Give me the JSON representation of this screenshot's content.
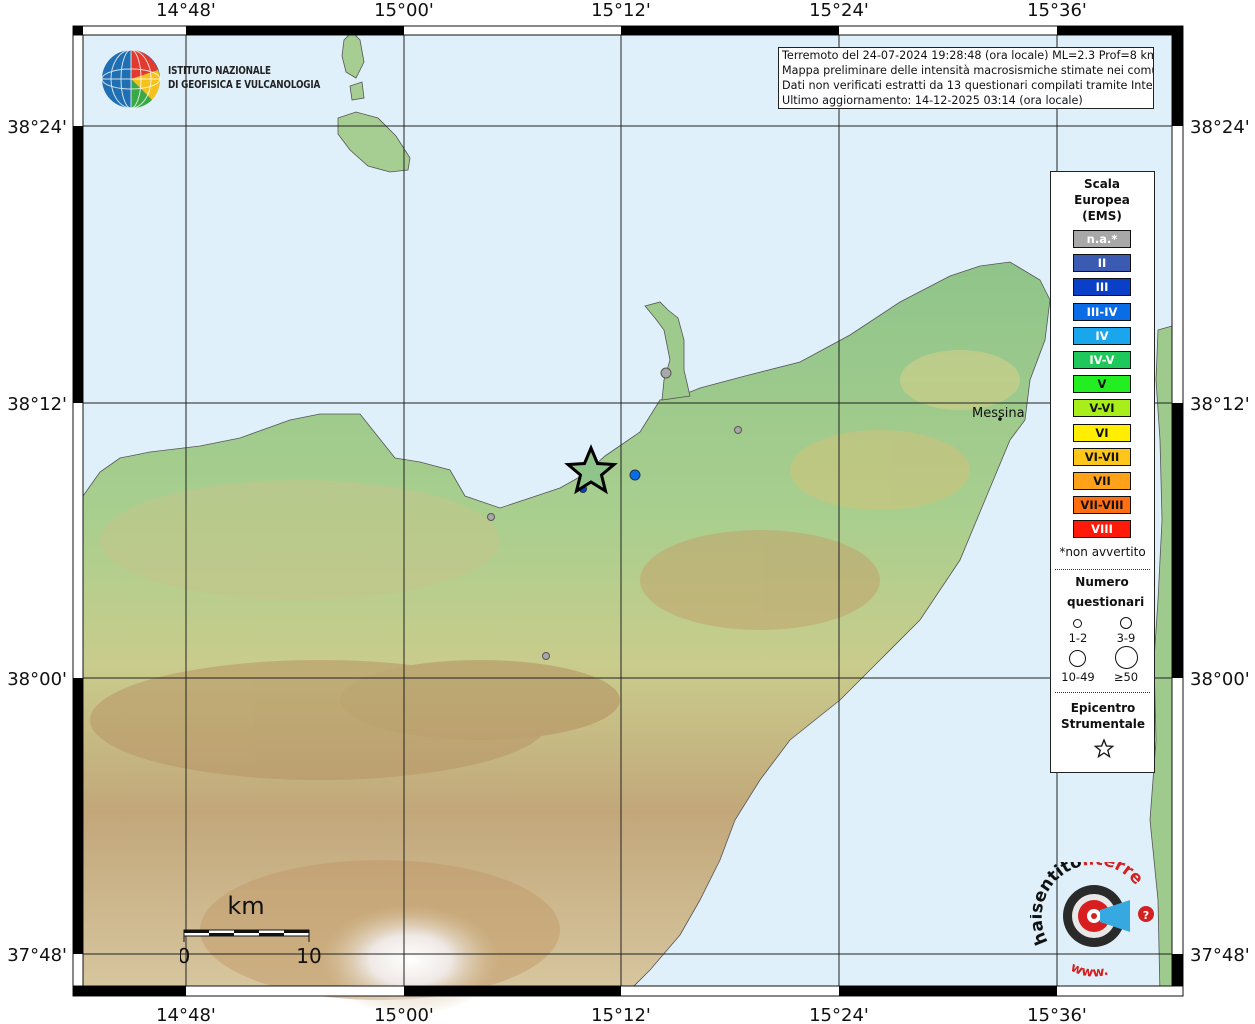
{
  "info_box": {
    "line1": "Terremoto del 24-07-2024 19:28:48 (ora locale) ML=2.3 Prof=8 km",
    "line2": "Mappa preliminare delle intensità macrosismiche stimate nei comuni",
    "line3": "Dati non verificati estratti da 13 questionari compilati tramite Internet.",
    "line4": "Ultimo aggiornamento: 14-12-2025 03:14 (ora locale)"
  },
  "institute": {
    "line1": "ISTITUTO NAZIONALE",
    "line2": "DI GEOFISICA E VULCANOLOGIA"
  },
  "axes": {
    "lon_labels": [
      "14°48'",
      "15°00'",
      "15°12'",
      "15°24'",
      "15°36'"
    ],
    "lat_labels": [
      "38°24'",
      "38°12'",
      "38°00'",
      "37°48'"
    ]
  },
  "places": {
    "city": "Messina"
  },
  "legend": {
    "title": "Scala Europea (EMS)",
    "scale": [
      {
        "label": "n.a.*",
        "color": "#a8a8a8"
      },
      {
        "label": "II",
        "color": "#3b5bb3"
      },
      {
        "label": "III",
        "color": "#0a3fc7"
      },
      {
        "label": "III-IV",
        "color": "#0a6ce6"
      },
      {
        "label": "IV",
        "color": "#1aa6ec"
      },
      {
        "label": "IV-V",
        "color": "#1ec85a"
      },
      {
        "label": "V",
        "color": "#22ee22"
      },
      {
        "label": "V-VI",
        "color": "#a8ee1a"
      },
      {
        "label": "VI",
        "color": "#ffee00"
      },
      {
        "label": "VI-VII",
        "color": "#ffc61a"
      },
      {
        "label": "VII",
        "color": "#ffa21a"
      },
      {
        "label": "VII-VIII",
        "color": "#ff6e10"
      },
      {
        "label": "VIII",
        "color": "#ff1a0a"
      }
    ],
    "note": "*non avvertito",
    "count_title": "Numero questionari",
    "count_classes": [
      "1-2",
      "3-9",
      "10-49",
      "≥50"
    ],
    "epicenter_title": "Epicentro Strumentale"
  },
  "observations": [
    {
      "ems": "n.a.*",
      "questionnaires": "1-2"
    },
    {
      "ems": "n.a.*",
      "questionnaires": "1-2"
    },
    {
      "ems": "n.a.*",
      "questionnaires": "1-2"
    },
    {
      "ems": "n.a.*",
      "questionnaires": "1-2"
    },
    {
      "ems": "III-IV",
      "questionnaires": "3-9"
    },
    {
      "ems": "III",
      "questionnaires": "1-2"
    }
  ],
  "scalebar": {
    "unit": "km",
    "start": "0",
    "end": "10"
  },
  "haisentito": {
    "text1": "haisentito",
    "text2": "ilterremoto.it",
    "url": "www."
  }
}
